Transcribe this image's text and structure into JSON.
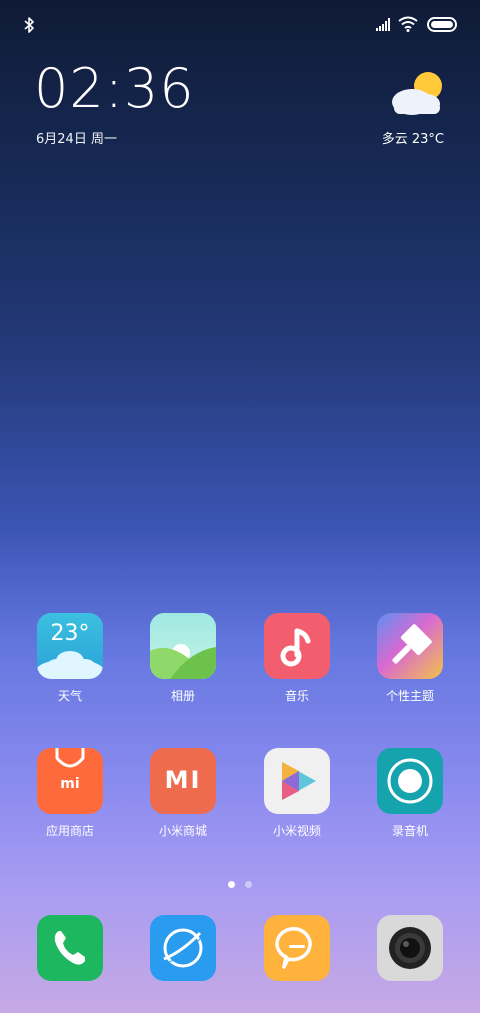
{
  "status_bar": {
    "icons": [
      "bluetooth-icon",
      "signal-icon",
      "wifi-icon",
      "battery-icon"
    ]
  },
  "widget": {
    "time": "02:36",
    "date": "6月24日 周一",
    "weather": "多云  23°C"
  },
  "apps_row1": [
    {
      "label": "天气",
      "icon": "weather-icon",
      "icon_text": "23°",
      "color": "#3cc0e0"
    },
    {
      "label": "相册",
      "icon": "gallery-icon",
      "color": "#8fd86a"
    },
    {
      "label": "音乐",
      "icon": "music-icon",
      "color": "#f25e6e"
    },
    {
      "label": "个性主题",
      "icon": "themes-icon",
      "color": "#e0a73a"
    }
  ],
  "apps_row2": [
    {
      "label": "应用商店",
      "icon": "app-store-icon",
      "icon_text": "mi",
      "color": "#ff6a3d"
    },
    {
      "label": "小米商城",
      "icon": "mi-store-icon",
      "icon_text": "MI",
      "color": "#ee6b4d"
    },
    {
      "label": "小米视频",
      "icon": "video-play-icon",
      "color": "#f0f0f0"
    },
    {
      "label": "录音机",
      "icon": "recorder-icon",
      "color": "#15a3ad"
    }
  ],
  "pager": {
    "pages": 2,
    "current": 1
  },
  "dock": [
    {
      "icon": "phone-icon",
      "color": "#1db760"
    },
    {
      "icon": "browser-icon",
      "color": "#2a9cf0"
    },
    {
      "icon": "messages-icon",
      "color": "#ffb23c"
    },
    {
      "icon": "camera-icon",
      "color": "#d9d9d9"
    }
  ]
}
